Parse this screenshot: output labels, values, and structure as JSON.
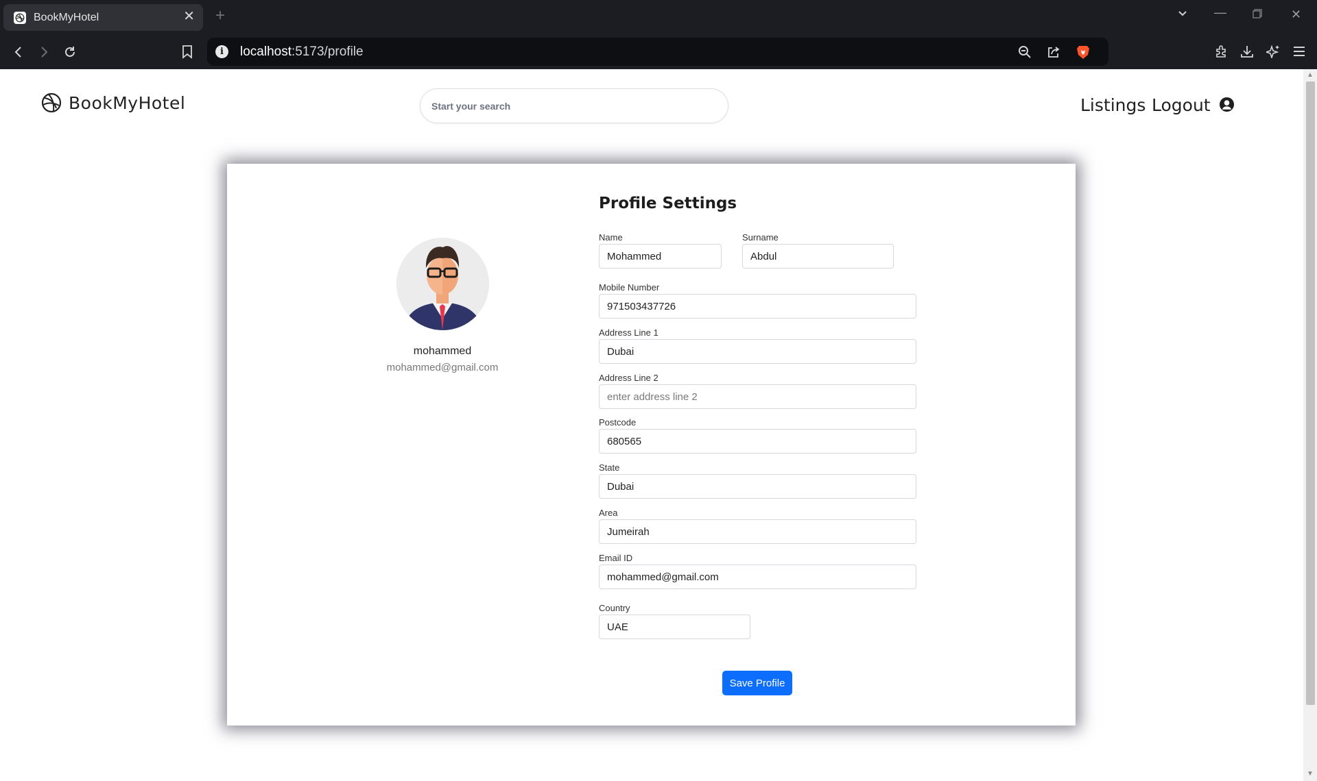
{
  "browser": {
    "tab_title": "BookMyHotel",
    "url_host": "localhost",
    "url_path": ":5173/profile"
  },
  "site": {
    "brand": "BookMyHotel",
    "search_placeholder": "Start your search",
    "nav": {
      "listings": "Listings",
      "logout": "Logout"
    }
  },
  "profile": {
    "username": "mohammed",
    "email": "mohammed@gmail.com"
  },
  "form": {
    "title": "Profile Settings",
    "fields": {
      "name": {
        "label": "Name",
        "value": "Mohammed"
      },
      "surname": {
        "label": "Surname",
        "value": "Abdul"
      },
      "mobile": {
        "label": "Mobile Number",
        "value": "971503437726"
      },
      "address1": {
        "label": "Address Line 1",
        "value": "Dubai"
      },
      "address2": {
        "label": "Address Line 2",
        "value": "",
        "placeholder": "enter address line 2"
      },
      "postcode": {
        "label": "Postcode",
        "value": "680565"
      },
      "state": {
        "label": "State",
        "value": "Dubai"
      },
      "area": {
        "label": "Area",
        "value": "Jumeirah"
      },
      "email": {
        "label": "Email ID",
        "value": "mohammed@gmail.com"
      },
      "country": {
        "label": "Country",
        "value": "UAE"
      }
    },
    "save_label": "Save Profile"
  },
  "colors": {
    "primary": "#0d6efd",
    "chrome": "#1c1d22"
  }
}
